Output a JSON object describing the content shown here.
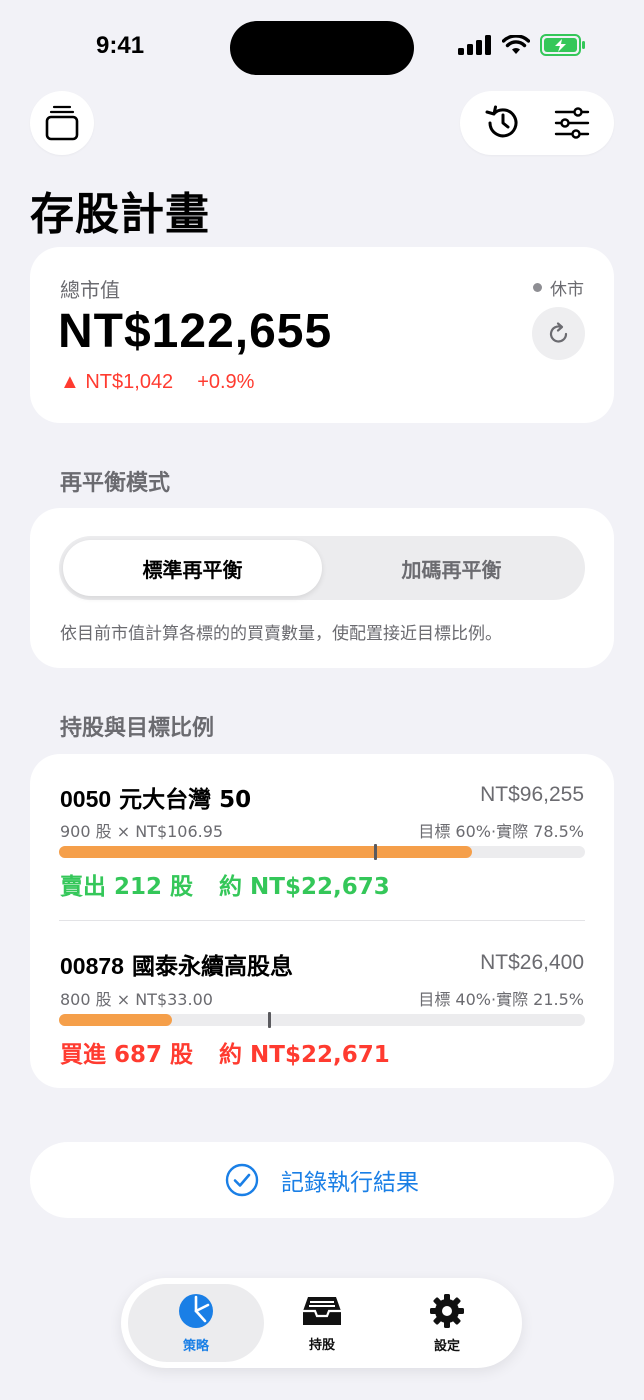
{
  "status": {
    "time": "9:41"
  },
  "header": {
    "title": "存股計畫"
  },
  "portfolio": {
    "label": "總市值",
    "market_status": "休市",
    "value": "NT$122,655",
    "change_amount": "▲ NT$1,042",
    "change_percent": "+0.9%",
    "change_color": "#ff3b30"
  },
  "rebalance": {
    "section_title": "再平衡模式",
    "modes": [
      "標準再平衡",
      "加碼再平衡"
    ],
    "selected": "標準再平衡",
    "description": "依目前市值計算各標的的買賣數量，使配置接近目標比例。"
  },
  "holdings": {
    "section_title": "持股與目標比例",
    "items": [
      {
        "code": "0050",
        "name": "元大台灣 50",
        "amount": "NT$96,255",
        "detail": "900 股 × NT$106.95",
        "ratio": "目標 60%·實際 78.5%",
        "target_pct": 60,
        "actual_pct": 78.5,
        "action": "賣出 212 股",
        "action_amount": "約 NT$22,673",
        "action_color": "#34c759"
      },
      {
        "code": "00878",
        "name": "國泰永續高股息",
        "amount": "NT$26,400",
        "detail": "800 股 × NT$33.00",
        "ratio": "目標 40%·實際 21.5%",
        "target_pct": 40,
        "actual_pct": 21.5,
        "action": "買進 687 股",
        "action_amount": "約 NT$22,671",
        "action_color": "#ff3b30"
      }
    ]
  },
  "record_button": {
    "label": "記錄執行結果"
  },
  "tabbar": {
    "tabs": [
      {
        "label": "策略",
        "icon": "pie-chart-icon",
        "active": true
      },
      {
        "label": "持股",
        "icon": "tray-icon",
        "active": false
      },
      {
        "label": "設定",
        "icon": "gear-icon",
        "active": false
      }
    ]
  },
  "colors": {
    "accent": "#1a7fe6",
    "bar_fill": "#f59f4a",
    "background": "#f2f2f7"
  }
}
